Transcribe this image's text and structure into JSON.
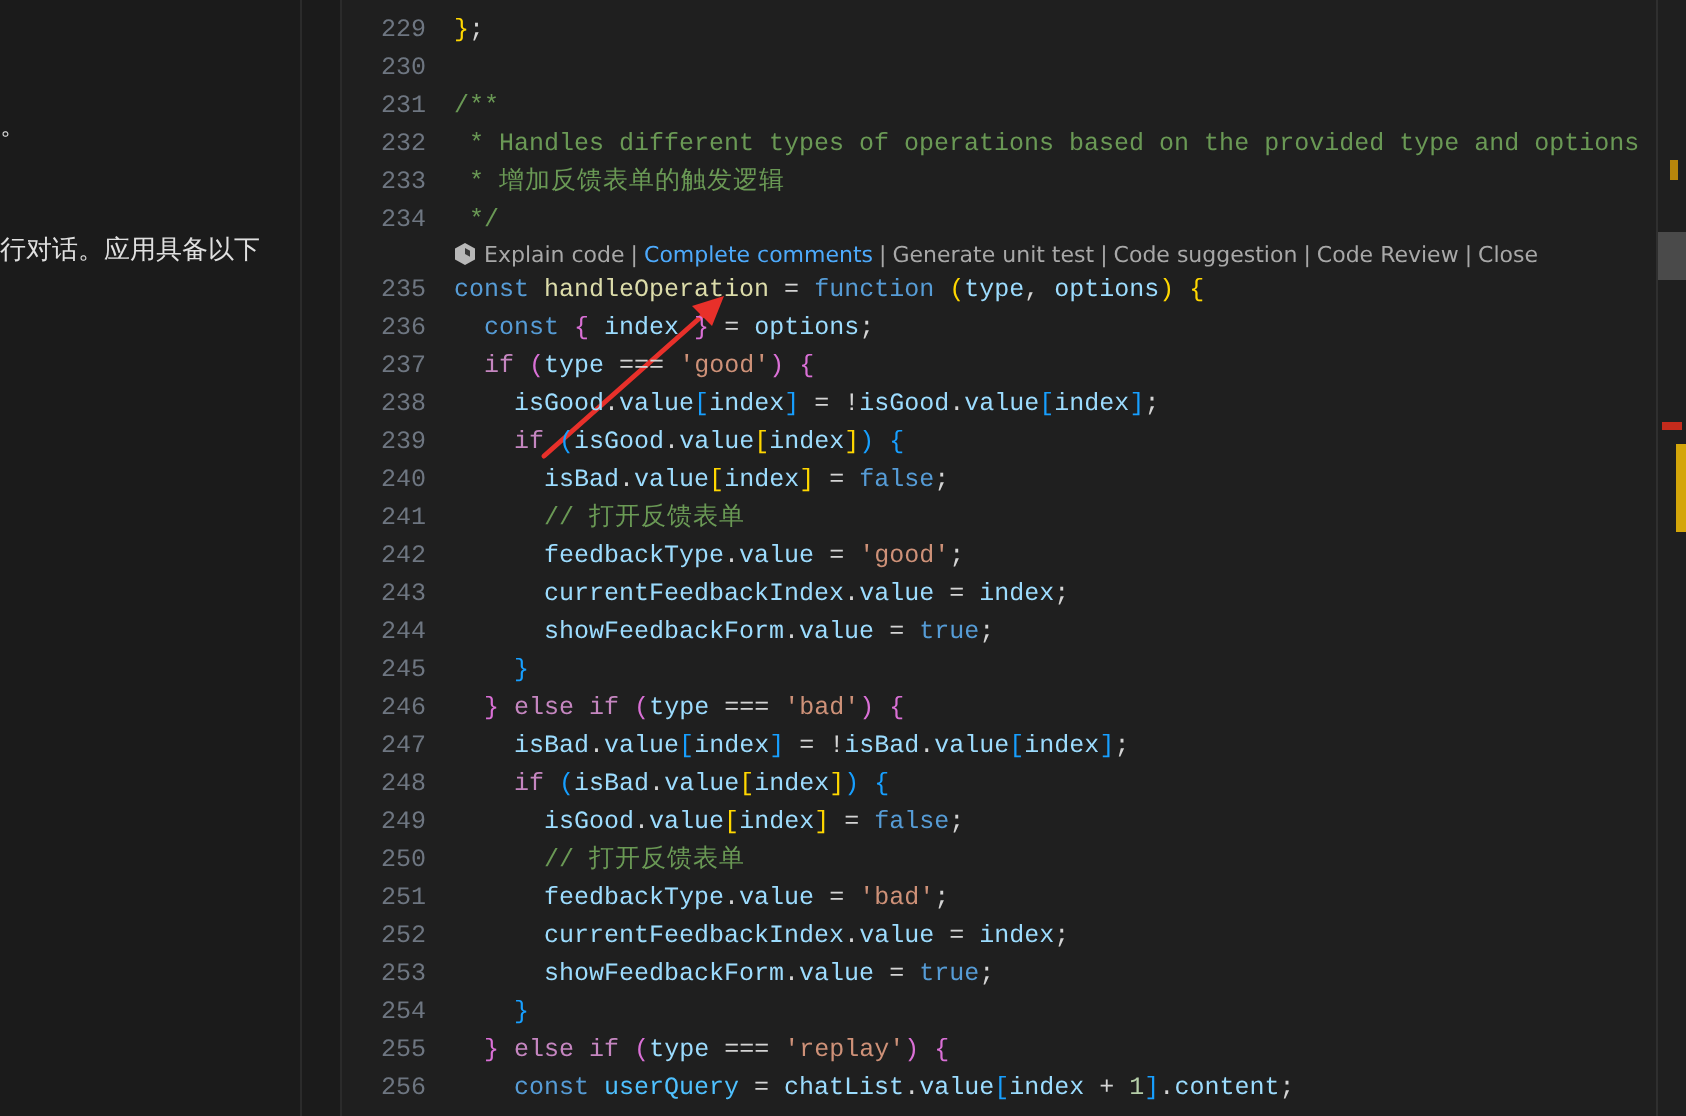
{
  "side_panel": {
    "lines": [
      "。",
      "行对话。应用具备以下"
    ]
  },
  "editor": {
    "blocks": [
      {
        "kind": "code",
        "lines": [
          {
            "number": "229",
            "tokens": [
              {
                "kind": "b1",
                "text": "}"
              },
              {
                "kind": "punc",
                "text": ";"
              }
            ]
          },
          {
            "number": "230"
          },
          {
            "number": "231",
            "tokens": [
              {
                "kind": "cmt",
                "text": "/**"
              }
            ]
          },
          {
            "number": "232",
            "tokens": [
              {
                "kind": "cmt",
                "text": " * Handles different types of operations based on the provided type and options"
              }
            ]
          },
          {
            "number": "233",
            "tokens": [
              {
                "kind": "cmt",
                "text": " * 增加反馈表单的触发逻辑"
              }
            ]
          },
          {
            "number": "234",
            "tokens": [
              {
                "kind": "cmt",
                "text": " */"
              }
            ]
          }
        ]
      },
      {
        "kind": "lens",
        "actions": [
          {
            "label": "Explain code",
            "hovered": false
          },
          {
            "label": "Complete comments",
            "hovered": true
          },
          {
            "label": "Generate unit test",
            "hovered": false
          },
          {
            "label": "Code suggestion",
            "hovered": false
          },
          {
            "label": "Code Review",
            "hovered": false
          },
          {
            "label": "Close",
            "hovered": false
          }
        ],
        "separator": "|"
      },
      {
        "kind": "code",
        "lines": [
          {
            "number": "235",
            "tokens": [
              {
                "kind": "kw",
                "text": "const"
              },
              {
                "kind": "fn",
                "text": " handleOperation"
              },
              {
                "kind": "punc",
                "text": " = "
              },
              {
                "kind": "kw",
                "text": "function"
              },
              {
                "kind": "b1",
                "text": " ("
              },
              {
                "kind": "var",
                "text": "type"
              },
              {
                "kind": "punc",
                "text": ", "
              },
              {
                "kind": "var",
                "text": "options"
              },
              {
                "kind": "b1",
                "text": ")"
              },
              {
                "kind": "b1",
                "text": " {"
              }
            ]
          },
          {
            "number": "236",
            "tokens": [
              {
                "kind": "kw",
                "text": "  const"
              },
              {
                "kind": "b2",
                "text": " {"
              },
              {
                "kind": "var",
                "text": " index"
              },
              {
                "kind": "b2",
                "text": " }"
              },
              {
                "kind": "punc",
                "text": " = "
              },
              {
                "kind": "var",
                "text": "options"
              },
              {
                "kind": "punc",
                "text": ";"
              }
            ]
          },
          {
            "number": "237",
            "tokens": [
              {
                "kind": "ctrl",
                "text": "  if"
              },
              {
                "kind": "b2",
                "text": " ("
              },
              {
                "kind": "var",
                "text": "type"
              },
              {
                "kind": "punc",
                "text": " === "
              },
              {
                "kind": "str",
                "text": "'good'"
              },
              {
                "kind": "b2",
                "text": ")"
              },
              {
                "kind": "b2",
                "text": " {"
              }
            ]
          },
          {
            "number": "238",
            "tokens": [
              {
                "kind": "var",
                "text": "    isGood"
              },
              {
                "kind": "punc",
                "text": "."
              },
              {
                "kind": "var",
                "text": "value"
              },
              {
                "kind": "b3",
                "text": "["
              },
              {
                "kind": "var",
                "text": "index"
              },
              {
                "kind": "b3",
                "text": "]"
              },
              {
                "kind": "punc",
                "text": " = !"
              },
              {
                "kind": "var",
                "text": "isGood"
              },
              {
                "kind": "punc",
                "text": "."
              },
              {
                "kind": "var",
                "text": "value"
              },
              {
                "kind": "b3",
                "text": "["
              },
              {
                "kind": "var",
                "text": "index"
              },
              {
                "kind": "b3",
                "text": "]"
              },
              {
                "kind": "punc",
                "text": ";"
              }
            ]
          },
          {
            "number": "239",
            "tokens": [
              {
                "kind": "ctrl",
                "text": "    if"
              },
              {
                "kind": "b3",
                "text": " ("
              },
              {
                "kind": "var",
                "text": "isGood"
              },
              {
                "kind": "punc",
                "text": "."
              },
              {
                "kind": "var",
                "text": "value"
              },
              {
                "kind": "b1",
                "text": "["
              },
              {
                "kind": "var",
                "text": "index"
              },
              {
                "kind": "b1",
                "text": "]"
              },
              {
                "kind": "b3",
                "text": ")"
              },
              {
                "kind": "b3",
                "text": " {"
              }
            ]
          },
          {
            "number": "240",
            "tokens": [
              {
                "kind": "var",
                "text": "      isBad"
              },
              {
                "kind": "punc",
                "text": "."
              },
              {
                "kind": "var",
                "text": "value"
              },
              {
                "kind": "b1",
                "text": "["
              },
              {
                "kind": "var",
                "text": "index"
              },
              {
                "kind": "b1",
                "text": "]"
              },
              {
                "kind": "punc",
                "text": " = "
              },
              {
                "kind": "kw",
                "text": "false"
              },
              {
                "kind": "punc",
                "text": ";"
              }
            ]
          },
          {
            "number": "241",
            "tokens": [
              {
                "kind": "cmt",
                "text": "      // 打开反馈表单"
              }
            ]
          },
          {
            "number": "242",
            "tokens": [
              {
                "kind": "var",
                "text": "      feedbackType"
              },
              {
                "kind": "punc",
                "text": "."
              },
              {
                "kind": "var",
                "text": "value"
              },
              {
                "kind": "punc",
                "text": " = "
              },
              {
                "kind": "str",
                "text": "'good'"
              },
              {
                "kind": "punc",
                "text": ";"
              }
            ]
          },
          {
            "number": "243",
            "tokens": [
              {
                "kind": "var",
                "text": "      currentFeedbackIndex"
              },
              {
                "kind": "punc",
                "text": "."
              },
              {
                "kind": "var",
                "text": "value"
              },
              {
                "kind": "punc",
                "text": " = "
              },
              {
                "kind": "var",
                "text": "index"
              },
              {
                "kind": "punc",
                "text": ";"
              }
            ]
          },
          {
            "number": "244",
            "tokens": [
              {
                "kind": "var",
                "text": "      showFeedbackForm"
              },
              {
                "kind": "punc",
                "text": "."
              },
              {
                "kind": "var",
                "text": "value"
              },
              {
                "kind": "punc",
                "text": " = "
              },
              {
                "kind": "kw",
                "text": "true"
              },
              {
                "kind": "punc",
                "text": ";"
              }
            ]
          },
          {
            "number": "245",
            "tokens": [
              {
                "kind": "b3",
                "text": "    }"
              }
            ]
          },
          {
            "number": "246",
            "tokens": [
              {
                "kind": "b2",
                "text": "  }"
              },
              {
                "kind": "ctrl",
                "text": " else"
              },
              {
                "kind": "ctrl",
                "text": " if"
              },
              {
                "kind": "b2",
                "text": " ("
              },
              {
                "kind": "var",
                "text": "type"
              },
              {
                "kind": "punc",
                "text": " === "
              },
              {
                "kind": "str",
                "text": "'bad'"
              },
              {
                "kind": "b2",
                "text": ")"
              },
              {
                "kind": "b2",
                "text": " {"
              }
            ]
          },
          {
            "number": "247",
            "tokens": [
              {
                "kind": "var",
                "text": "    isBad"
              },
              {
                "kind": "punc",
                "text": "."
              },
              {
                "kind": "var",
                "text": "value"
              },
              {
                "kind": "b3",
                "text": "["
              },
              {
                "kind": "var",
                "text": "index"
              },
              {
                "kind": "b3",
                "text": "]"
              },
              {
                "kind": "punc",
                "text": " = !"
              },
              {
                "kind": "var",
                "text": "isBad"
              },
              {
                "kind": "punc",
                "text": "."
              },
              {
                "kind": "var",
                "text": "value"
              },
              {
                "kind": "b3",
                "text": "["
              },
              {
                "kind": "var",
                "text": "index"
              },
              {
                "kind": "b3",
                "text": "]"
              },
              {
                "kind": "punc",
                "text": ";"
              }
            ]
          },
          {
            "number": "248",
            "tokens": [
              {
                "kind": "ctrl",
                "text": "    if"
              },
              {
                "kind": "b3",
                "text": " ("
              },
              {
                "kind": "var",
                "text": "isBad"
              },
              {
                "kind": "punc",
                "text": "."
              },
              {
                "kind": "var",
                "text": "value"
              },
              {
                "kind": "b1",
                "text": "["
              },
              {
                "kind": "var",
                "text": "index"
              },
              {
                "kind": "b1",
                "text": "]"
              },
              {
                "kind": "b3",
                "text": ")"
              },
              {
                "kind": "b3",
                "text": " {"
              }
            ]
          },
          {
            "number": "249",
            "tokens": [
              {
                "kind": "var",
                "text": "      isGood"
              },
              {
                "kind": "punc",
                "text": "."
              },
              {
                "kind": "var",
                "text": "value"
              },
              {
                "kind": "b1",
                "text": "["
              },
              {
                "kind": "var",
                "text": "index"
              },
              {
                "kind": "b1",
                "text": "]"
              },
              {
                "kind": "punc",
                "text": " = "
              },
              {
                "kind": "kw",
                "text": "false"
              },
              {
                "kind": "punc",
                "text": ";"
              }
            ]
          },
          {
            "number": "250",
            "tokens": [
              {
                "kind": "cmt",
                "text": "      // 打开反馈表单"
              }
            ]
          },
          {
            "number": "251",
            "tokens": [
              {
                "kind": "var",
                "text": "      feedbackType"
              },
              {
                "kind": "punc",
                "text": "."
              },
              {
                "kind": "var",
                "text": "value"
              },
              {
                "kind": "punc",
                "text": " = "
              },
              {
                "kind": "str",
                "text": "'bad'"
              },
              {
                "kind": "punc",
                "text": ";"
              }
            ]
          },
          {
            "number": "252",
            "tokens": [
              {
                "kind": "var",
                "text": "      currentFeedbackIndex"
              },
              {
                "kind": "punc",
                "text": "."
              },
              {
                "kind": "var",
                "text": "value"
              },
              {
                "kind": "punc",
                "text": " = "
              },
              {
                "kind": "var",
                "text": "index"
              },
              {
                "kind": "punc",
                "text": ";"
              }
            ]
          },
          {
            "number": "253",
            "tokens": [
              {
                "kind": "var",
                "text": "      showFeedbackForm"
              },
              {
                "kind": "punc",
                "text": "."
              },
              {
                "kind": "var",
                "text": "value"
              },
              {
                "kind": "punc",
                "text": " = "
              },
              {
                "kind": "kw",
                "text": "true"
              },
              {
                "kind": "punc",
                "text": ";"
              }
            ]
          },
          {
            "number": "254",
            "tokens": [
              {
                "kind": "b3",
                "text": "    }"
              }
            ]
          },
          {
            "number": "255",
            "tokens": [
              {
                "kind": "b2",
                "text": "  }"
              },
              {
                "kind": "ctrl",
                "text": " else"
              },
              {
                "kind": "ctrl",
                "text": " if"
              },
              {
                "kind": "b2",
                "text": " ("
              },
              {
                "kind": "var",
                "text": "type"
              },
              {
                "kind": "punc",
                "text": " === "
              },
              {
                "kind": "str",
                "text": "'replay'"
              },
              {
                "kind": "b2",
                "text": ")"
              },
              {
                "kind": "b2",
                "text": " {"
              }
            ]
          },
          {
            "number": "256",
            "tokens": [
              {
                "kind": "kw",
                "text": "    const"
              },
              {
                "kind": "const",
                "text": " userQuery"
              },
              {
                "kind": "punc",
                "text": " = "
              },
              {
                "kind": "var",
                "text": "chatList"
              },
              {
                "kind": "punc",
                "text": "."
              },
              {
                "kind": "var",
                "text": "value"
              },
              {
                "kind": "b3",
                "text": "["
              },
              {
                "kind": "var",
                "text": "index"
              },
              {
                "kind": "punc",
                "text": " + "
              },
              {
                "kind": "num",
                "text": "1"
              },
              {
                "kind": "b3",
                "text": "]"
              },
              {
                "kind": "punc",
                "text": "."
              },
              {
                "kind": "var",
                "text": "content"
              },
              {
                "kind": "punc",
                "text": ";"
              }
            ]
          }
        ]
      }
    ]
  }
}
